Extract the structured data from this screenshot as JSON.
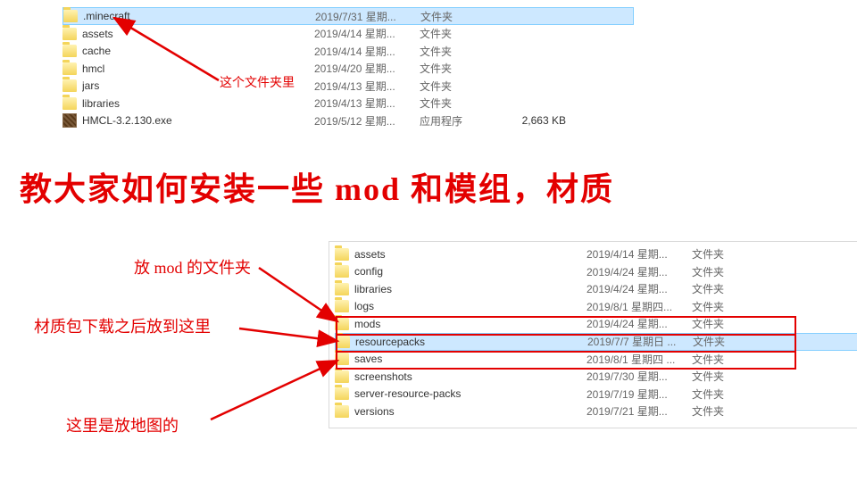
{
  "annotations": {
    "thisFolder": "这个文件夹里",
    "title": "教大家如何安装一些 mod 和模组，材质",
    "modFolder": "放 mod 的文件夹",
    "texturePack": "材质包下载之后放到这里",
    "mapsHere": "这里是放地图的"
  },
  "topList": [
    {
      "name": ".minecraft",
      "date": "2019/7/31 星期...",
      "type": "文件夹",
      "size": "",
      "icon": "folder",
      "selected": true
    },
    {
      "name": "assets",
      "date": "2019/4/14 星期...",
      "type": "文件夹",
      "size": "",
      "icon": "folder"
    },
    {
      "name": "cache",
      "date": "2019/4/14 星期...",
      "type": "文件夹",
      "size": "",
      "icon": "folder"
    },
    {
      "name": "hmcl",
      "date": "2019/4/20 星期...",
      "type": "文件夹",
      "size": "",
      "icon": "folder"
    },
    {
      "name": "jars",
      "date": "2019/4/13 星期...",
      "type": "文件夹",
      "size": "",
      "icon": "folder"
    },
    {
      "name": "libraries",
      "date": "2019/4/13 星期...",
      "type": "文件夹",
      "size": "",
      "icon": "folder"
    },
    {
      "name": "HMCL-3.2.130.exe",
      "date": "2019/5/12 星期...",
      "type": "应用程序",
      "size": "2,663 KB",
      "icon": "exe"
    }
  ],
  "bottomList": [
    {
      "name": "assets",
      "date": "2019/4/14 星期...",
      "type": "文件夹"
    },
    {
      "name": "config",
      "date": "2019/4/24 星期...",
      "type": "文件夹"
    },
    {
      "name": "libraries",
      "date": "2019/4/24 星期...",
      "type": "文件夹"
    },
    {
      "name": "logs",
      "date": "2019/8/1 星期四...",
      "type": "文件夹"
    },
    {
      "name": "mods",
      "date": "2019/4/24 星期...",
      "type": "文件夹"
    },
    {
      "name": "resourcepacks",
      "date": "2019/7/7 星期日 ...",
      "type": "文件夹",
      "selected": true
    },
    {
      "name": "saves",
      "date": "2019/8/1 星期四 ...",
      "type": "文件夹"
    },
    {
      "name": "screenshots",
      "date": "2019/7/30 星期...",
      "type": "文件夹"
    },
    {
      "name": "server-resource-packs",
      "date": "2019/7/19 星期...",
      "type": "文件夹"
    },
    {
      "name": "versions",
      "date": "2019/7/21 星期...",
      "type": "文件夹"
    }
  ]
}
